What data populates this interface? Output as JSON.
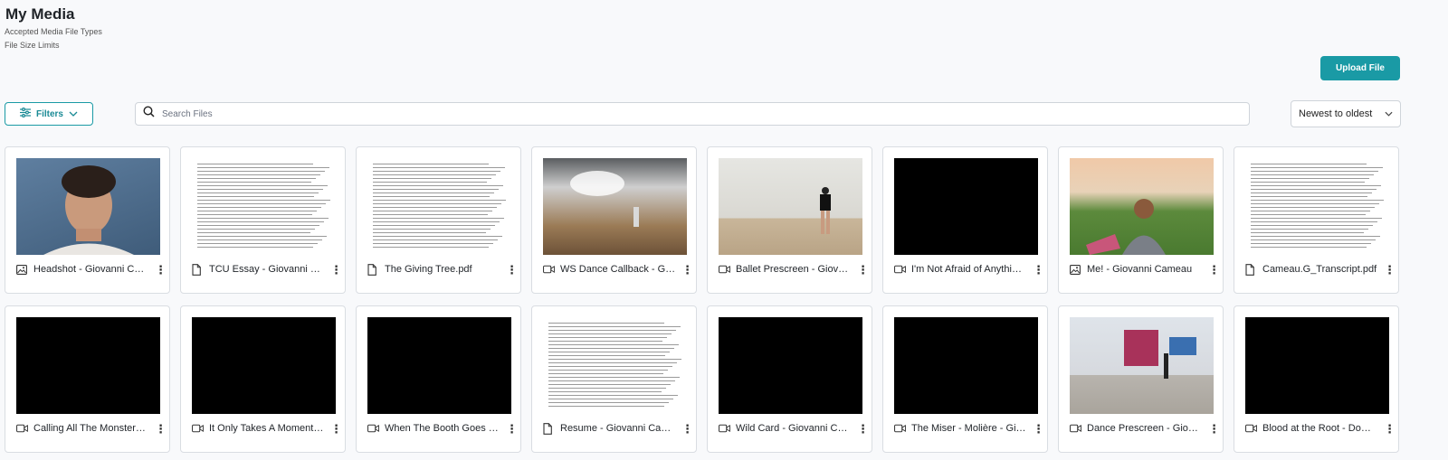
{
  "page": {
    "title": "My Media",
    "accepted_types_link": "Accepted Media File Types",
    "size_limits_link": "File Size Limits",
    "upload_label": "Upload File"
  },
  "toolbar": {
    "filters_label": "Filters",
    "search_placeholder": "Search Files",
    "sort_value": "Newest to oldest"
  },
  "colors": {
    "accent": "#1a9aa5"
  },
  "media": [
    {
      "name": "Headshot - Giovanni Cameau",
      "type": "image",
      "thumb": "photo"
    },
    {
      "name": "TCU Essay - Giovanni Cameau.pdf",
      "type": "document",
      "thumb": "doc"
    },
    {
      "name": "The Giving Tree.pdf",
      "type": "document",
      "thumb": "doc"
    },
    {
      "name": "WS Dance Callback - Giovanni Cameau",
      "type": "video",
      "thumb": "gym"
    },
    {
      "name": "Ballet Prescreen - Giovanni Cameau",
      "type": "video",
      "thumb": "studio"
    },
    {
      "name": "I'm Not Afraid of Anything - Giovanni Cameau",
      "type": "video",
      "thumb": "black"
    },
    {
      "name": "Me! - Giovanni Cameau",
      "type": "image",
      "thumb": "field"
    },
    {
      "name": "Cameau.G_Transcript.pdf",
      "type": "document",
      "thumb": "doc"
    },
    {
      "name": "Calling All The Monsters - Giovanni Cameau",
      "type": "video",
      "thumb": "black"
    },
    {
      "name": "It Only Takes A Moment - Giovanni Cameau",
      "type": "video",
      "thumb": "black"
    },
    {
      "name": "When The Booth Goes Bright - Giovanni Cameau",
      "type": "video",
      "thumb": "black"
    },
    {
      "name": "Resume - Giovanni Cameau.pdf",
      "type": "document",
      "thumb": "doc"
    },
    {
      "name": "Wild Card - Giovanni Cameau",
      "type": "video",
      "thumb": "black"
    },
    {
      "name": "The Miser - Molière - Giovanni Cameau",
      "type": "video",
      "thumb": "black"
    },
    {
      "name": "Dance Prescreen - Giovanni Cameau",
      "type": "video",
      "thumb": "dance2"
    },
    {
      "name": "Blood at the Root - Dominique Morisseau",
      "type": "video",
      "thumb": "black"
    }
  ]
}
